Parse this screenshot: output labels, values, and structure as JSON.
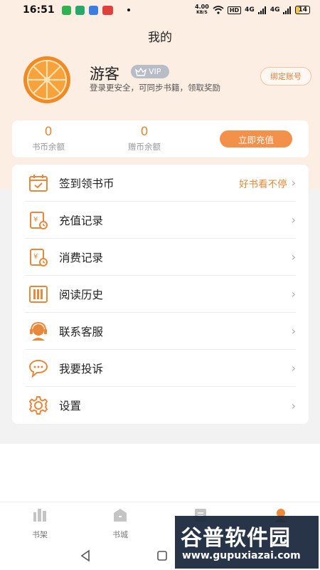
{
  "status_bar": {
    "time": "16:51",
    "net_speed": "4.00",
    "net_unit": "KB/S",
    "hd": "HD",
    "signal1": "4G",
    "signal2": "4G",
    "battery": "14"
  },
  "page_title": "我的",
  "profile": {
    "username": "游客",
    "vip": "VIP",
    "login_tip": "登录更安全，可同步书籍，领取奖励",
    "bind_button": "绑定账号"
  },
  "balance": {
    "coin_value": "0",
    "coin_label": "书币余额",
    "gift_value": "0",
    "gift_label": "赠币余额",
    "recharge_button": "立即充值"
  },
  "menu": {
    "items": [
      {
        "label": "签到领书币",
        "extra": "好书看不停",
        "icon": "calendar-check-icon"
      },
      {
        "label": "充值记录",
        "icon": "recharge-record-icon"
      },
      {
        "label": "消费记录",
        "icon": "consume-record-icon"
      },
      {
        "label": "阅读历史",
        "icon": "books-icon"
      },
      {
        "label": "联系客服",
        "icon": "customer-service-icon"
      },
      {
        "label": "我要投诉",
        "icon": "chat-bubble-icon"
      },
      {
        "label": "设置",
        "icon": "gear-icon"
      }
    ]
  },
  "bottom_nav": {
    "tabs": [
      {
        "label": "书架"
      },
      {
        "label": "书城"
      }
    ]
  },
  "watermark": {
    "title": "谷普软件园",
    "url": "www.gupuxiazai.com"
  },
  "colors": {
    "accent": "#f3904a",
    "accent_text": "#e08a3b",
    "header_bg": "#fdeee3"
  }
}
